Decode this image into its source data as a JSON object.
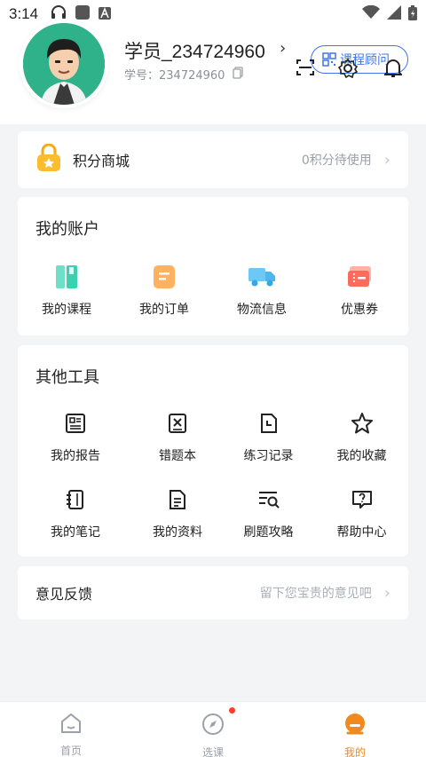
{
  "status_bar": {
    "time": "3:14"
  },
  "header": {
    "user_name": "学员_234724960",
    "student_id_label": "学号：234724960",
    "advisor_label": "课程顾问"
  },
  "points": {
    "title": "积分商城",
    "status": "0积分待使用"
  },
  "account": {
    "title": "我的账户",
    "items": [
      {
        "label": "我的课程",
        "icon": "book-icon"
      },
      {
        "label": "我的订单",
        "icon": "order-icon"
      },
      {
        "label": "物流信息",
        "icon": "truck-icon"
      },
      {
        "label": "优惠券",
        "icon": "coupon-icon"
      }
    ]
  },
  "tools": {
    "title": "其他工具",
    "items": [
      {
        "label": "我的报告",
        "icon": "report-icon"
      },
      {
        "label": "错题本",
        "icon": "wrong-book-icon"
      },
      {
        "label": "练习记录",
        "icon": "practice-record-icon"
      },
      {
        "label": "我的收藏",
        "icon": "star-icon"
      },
      {
        "label": "我的笔记",
        "icon": "notebook-icon"
      },
      {
        "label": "我的资料",
        "icon": "document-icon"
      },
      {
        "label": "刷题攻略",
        "icon": "search-list-icon"
      },
      {
        "label": "帮助中心",
        "icon": "help-icon"
      }
    ]
  },
  "feedback": {
    "title": "意见反馈",
    "hint": "留下您宝贵的意见吧"
  },
  "nav": {
    "items": [
      {
        "label": "首页",
        "icon": "home-icon"
      },
      {
        "label": "选课",
        "icon": "compass-icon"
      },
      {
        "label": "我的",
        "icon": "profile-icon"
      }
    ]
  },
  "colors": {
    "accent": "#f08a1e",
    "advisor_blue": "#3f75f0",
    "avatar_bg": "#2fb28a"
  }
}
